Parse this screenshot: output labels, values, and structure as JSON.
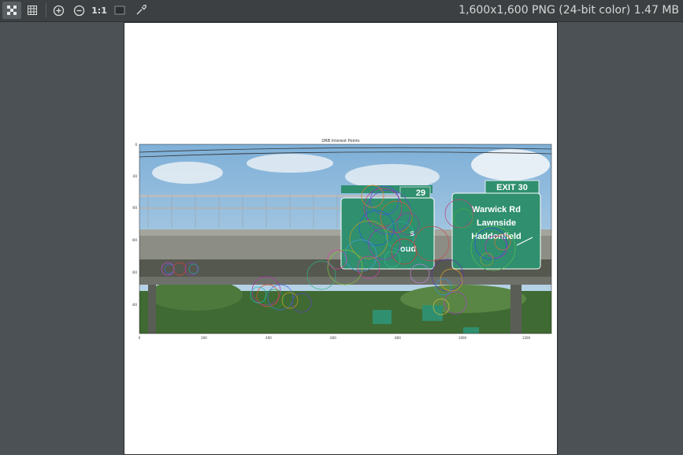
{
  "toolbar": {
    "buttons": [
      {
        "name": "fit-to-window-icon",
        "active": true
      },
      {
        "name": "grid-icon",
        "active": false
      },
      {
        "name": "zoom-in-icon",
        "active": false
      },
      {
        "name": "zoom-out-icon",
        "active": false
      },
      {
        "name": "actual-size-button",
        "label": "1:1",
        "active": false
      },
      {
        "name": "background-icon",
        "active": false
      },
      {
        "name": "color-picker-icon",
        "active": false
      }
    ],
    "actual_size_label": "1:1"
  },
  "image_info": "1,600x1,600 PNG (24-bit color) 1.47 MB",
  "figure": {
    "title": "ORB Interest Points",
    "y_ticks": [
      "0",
      "100",
      "200",
      "300",
      "400",
      "500"
    ],
    "x_ticks": [
      "0",
      "200",
      "400",
      "600",
      "800",
      "1000",
      "1200"
    ],
    "sign_left_exit": "29",
    "sign_right_exit": "EXIT 30",
    "sign_right_lines": [
      "Warwick Rd",
      "Lawnside",
      "Haddonfield"
    ],
    "sign_left_text": [
      "s",
      "oud"
    ]
  },
  "colors": {
    "toolbar_bg": "#3c4042",
    "viewer_bg": "#4b5154",
    "sign_green": "#2f8f6e"
  }
}
